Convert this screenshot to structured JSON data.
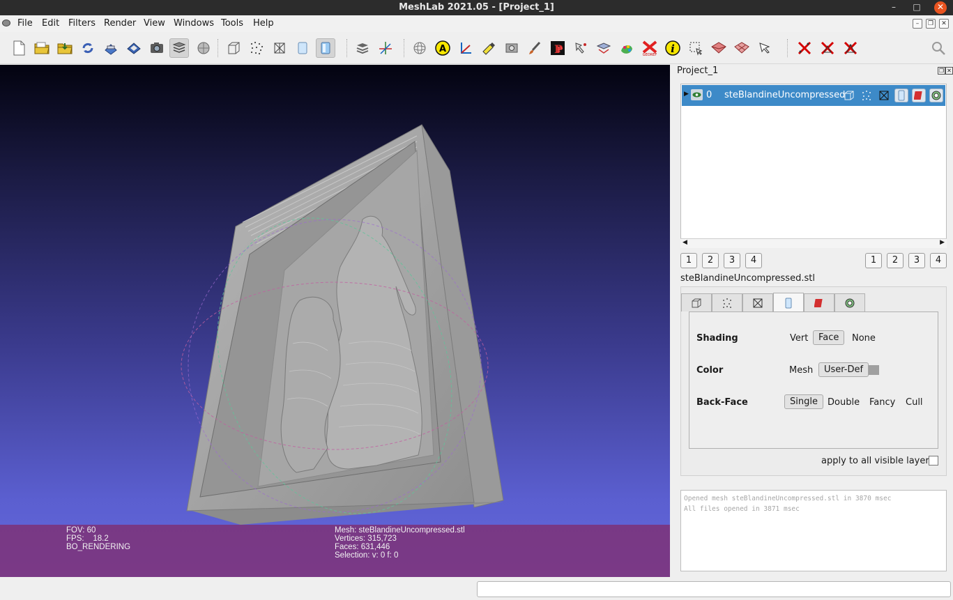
{
  "window": {
    "title": "MeshLab 2021.05 - [Project_1]",
    "controls": {
      "minimize": "–",
      "maximize": "□",
      "close": "✕"
    }
  },
  "menubar": {
    "items": [
      "File",
      "Edit",
      "Filters",
      "Render",
      "View",
      "Windows",
      "Tools",
      "Help"
    ],
    "mdi_controls": [
      "–",
      "❐",
      "✕"
    ]
  },
  "viewport": {
    "info_left": [
      "FOV: 60",
      "FPS:    18.2",
      "BO_RENDERING"
    ],
    "info_right": [
      "Mesh: steBlandineUncompressed.stl",
      "Vertices: 315,723",
      "Faces: 631,446",
      "Selection: v: 0 f: 0"
    ],
    "colors": {
      "mesh": "#a3a3a3",
      "info_overlay": "#802d6e"
    }
  },
  "panel": {
    "title": "Project_1",
    "layer": {
      "index": "0",
      "name": "steBlandineUncompressed"
    },
    "left_buttons": [
      "1",
      "2",
      "3",
      "4"
    ],
    "right_buttons": [
      "1",
      "2",
      "3",
      "4"
    ],
    "mesh_label": "steBlandineUncompressed.stl",
    "shading": {
      "label": "Shading",
      "options": [
        "Vert",
        "Face",
        "None"
      ],
      "selected": "Face"
    },
    "color": {
      "label": "Color",
      "options": [
        "Mesh",
        "User-Def"
      ],
      "selected": "User-Def",
      "swatch": "#a0a0a0"
    },
    "backface": {
      "label": "Back-Face",
      "options": [
        "Single",
        "Double",
        "Fancy",
        "Cull"
      ],
      "selected": "Single"
    },
    "apply_all": "apply to all visible layers"
  },
  "log": [
    "Opened mesh steBlandineUncompressed.stl in 3870 msec",
    "All files opened in 3871 msec"
  ],
  "colors": {
    "accent": "#3d8ac8",
    "titlebar": "#2c2c2c",
    "close": "#e95420"
  }
}
